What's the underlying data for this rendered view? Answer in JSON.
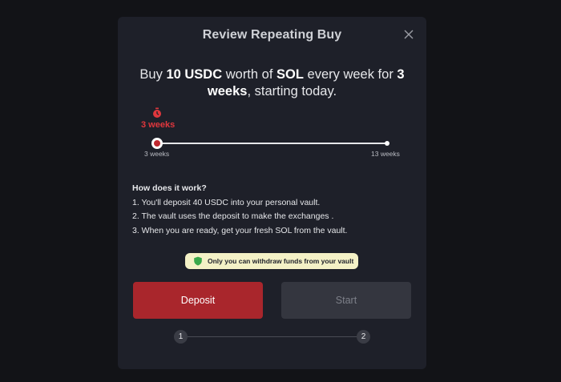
{
  "modal": {
    "title": "Review Repeating Buy"
  },
  "summary": {
    "prefix": "Buy ",
    "amount": "10 USDC",
    "mid1": " worth of ",
    "asset": "SOL",
    "mid2": " every week for ",
    "duration": "3 weeks",
    "suffix": ", starting today."
  },
  "slider": {
    "current_label": "3 weeks",
    "min_label": "3 weeks",
    "max_label": "13 weeks",
    "value_fraction": 0
  },
  "how_it_works": {
    "title": "How does it work?",
    "steps": [
      "1. You'll deposit 40 USDC into your personal vault.",
      "2. The vault uses the deposit to make the exchanges .",
      "3. When you are ready, get your fresh SOL from the vault."
    ]
  },
  "badge": {
    "text": "Only you can withdraw funds from your vault",
    "icon": "shield-icon"
  },
  "buttons": {
    "deposit": "Deposit",
    "start": "Start"
  },
  "stepper": {
    "step1": "1",
    "step2": "2"
  },
  "colors": {
    "background": "#121317",
    "modal": "#1e2029",
    "accent_red": "#a9262c",
    "label_red": "#e0373d",
    "badge_bg": "#f4f1c6",
    "shield_green": "#3aa84a"
  }
}
